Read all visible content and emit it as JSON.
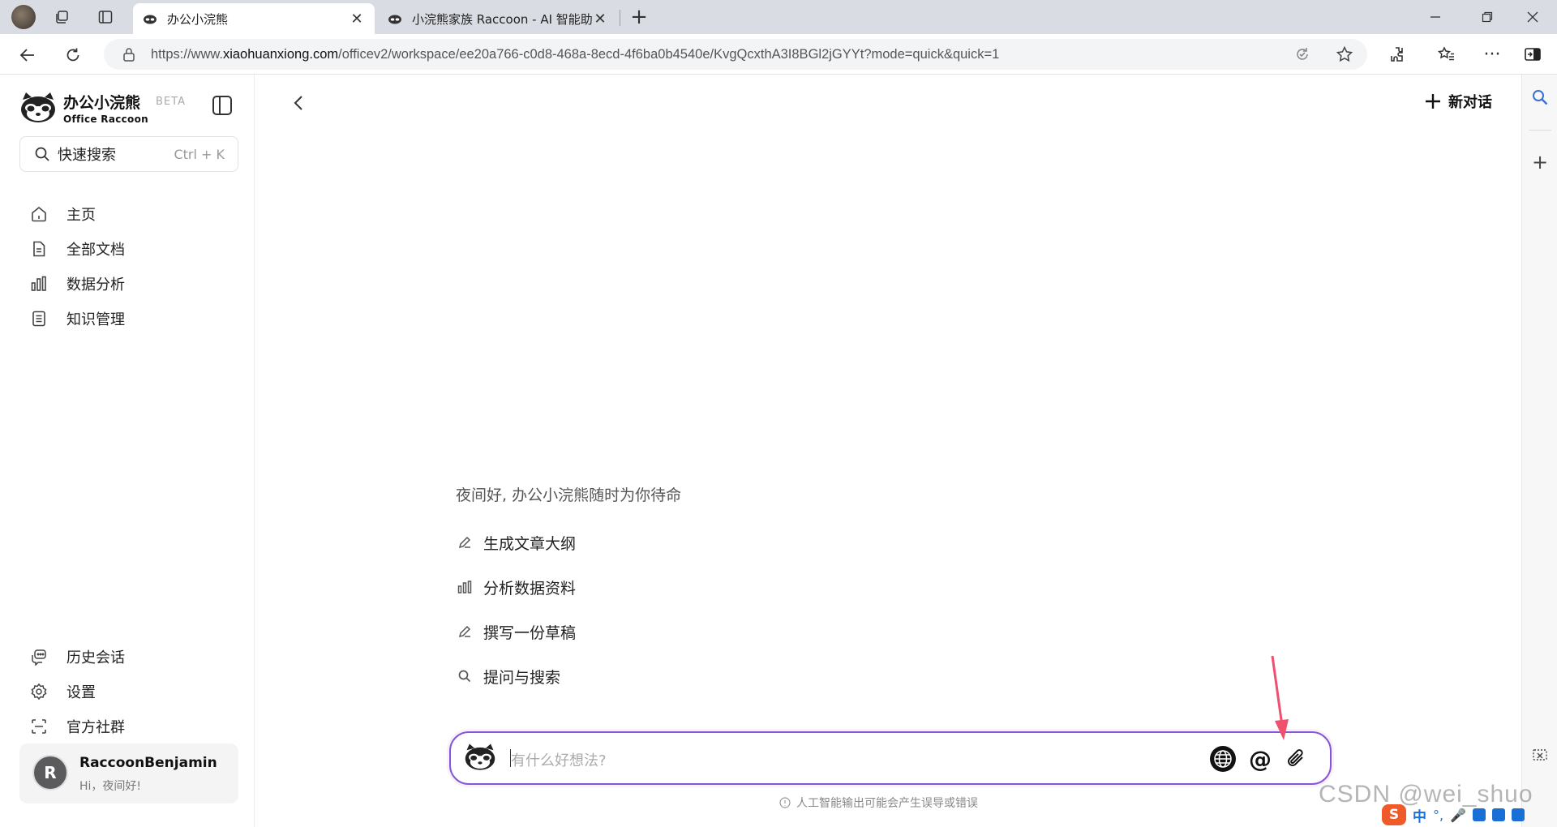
{
  "browser": {
    "tabs": [
      {
        "title": "办公小浣熊",
        "active": true
      },
      {
        "title": "小浣熊家族 Raccoon - AI 智能助手",
        "active": false
      }
    ],
    "url_prefix": "https://www.",
    "url_domain": "xiaohuanxiong.com",
    "url_path": "/officev2/workspace/ee20a766-c0d8-468a-8ecd-4f6ba0b4540e/KvgQcxthA3I8BGl2jGYYt?mode=quick&quick=1"
  },
  "sidebar": {
    "brand_cn": "办公小浣熊",
    "brand_en": "Office Raccoon",
    "beta": "BETA",
    "search_label": "快速搜索",
    "search_shortcut": "Ctrl + K",
    "nav": [
      {
        "label": "主页",
        "icon": "home-icon"
      },
      {
        "label": "全部文档",
        "icon": "document-icon"
      },
      {
        "label": "数据分析",
        "icon": "bar-chart-icon"
      },
      {
        "label": "知识管理",
        "icon": "notebook-icon"
      }
    ],
    "bottom_nav": [
      {
        "label": "历史会话",
        "icon": "chat-history-icon"
      },
      {
        "label": "设置",
        "icon": "gear-icon"
      },
      {
        "label": "官方社群",
        "icon": "scan-icon"
      }
    ],
    "user": {
      "initial": "R",
      "name": "RaccoonBenjamin",
      "greeting": "Hi，夜间好!"
    }
  },
  "main": {
    "new_chat": "新对话",
    "greeting": "夜间好, 办公小浣熊随时为你待命",
    "suggestions": [
      {
        "label": "生成文章大纲",
        "icon": "pencil-icon"
      },
      {
        "label": "分析数据资料",
        "icon": "bar-chart-icon"
      },
      {
        "label": "撰写一份草稿",
        "icon": "pencil-icon"
      },
      {
        "label": "提问与搜索",
        "icon": "search-icon"
      }
    ],
    "input_placeholder": "有什么好想法?",
    "disclaimer": "人工智能输出可能会产生误导或错误"
  },
  "overlay": {
    "watermark": "CSDN @wei_shuo",
    "ime_label": "中",
    "annotation_color": "#f0506e"
  }
}
